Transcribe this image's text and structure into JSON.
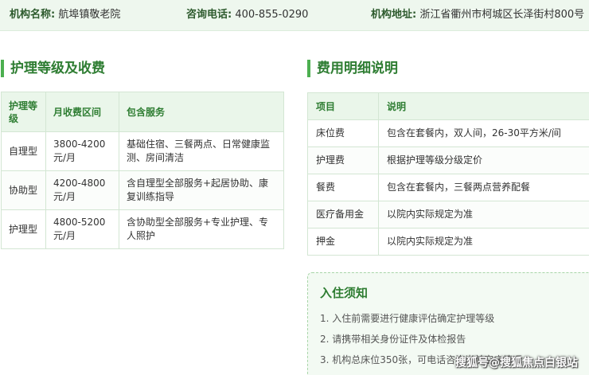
{
  "info_bar": {
    "name_label": "机构名称:",
    "name_value": "航埠镇敬老院",
    "phone_label": "咨询电话:",
    "phone_value": "400-855-0290",
    "address_label": "机构地址:",
    "address_value": "浙江省衢州市柯城区长泽街村800号"
  },
  "care_section": {
    "title": "护理等级及收费",
    "columns": [
      "护理等级",
      "月收费区间",
      "包含服务"
    ],
    "rows": [
      {
        "level": "自理型",
        "fee": "3800-4200元/月",
        "services": "基础住宿、三餐两点、日常健康监测、房间清洁"
      },
      {
        "level": "协助型",
        "fee": "4200-4800元/月",
        "services": "含自理型全部服务+起居协助、康复训练指导"
      },
      {
        "level": "护理型",
        "fee": "4800-5200元/月",
        "services": "含协助型全部服务+专业护理、专人照护"
      }
    ]
  },
  "fee_section": {
    "title": "费用明细说明",
    "columns": [
      "项目",
      "说明"
    ],
    "rows": [
      {
        "item": "床位费",
        "desc": "包含在套餐内，双人间，26-30平方米/间"
      },
      {
        "item": "护理费",
        "desc": "根据护理等级分级定价"
      },
      {
        "item": "餐费",
        "desc": "包含在套餐内，三餐两点营养配餐"
      },
      {
        "item": "医疗备用金",
        "desc": "以院内实际规定为准"
      },
      {
        "item": "押金",
        "desc": "以院内实际规定为准"
      }
    ]
  },
  "notice": {
    "title": "入住须知",
    "items": [
      "1. 入住前需要进行健康评估确定护理等级",
      "2. 请携带相关身份证件及体检报告",
      "3. 机构总床位350张，可电话咨询当前空床情况"
    ]
  },
  "watermark": "搜狐号@搜狐焦点白银站",
  "colors": {
    "accent": "#2e7d32",
    "accent_bar": "#4caf50",
    "header_bg": "#eaf6ea",
    "info_bg": "#eef7ee"
  }
}
